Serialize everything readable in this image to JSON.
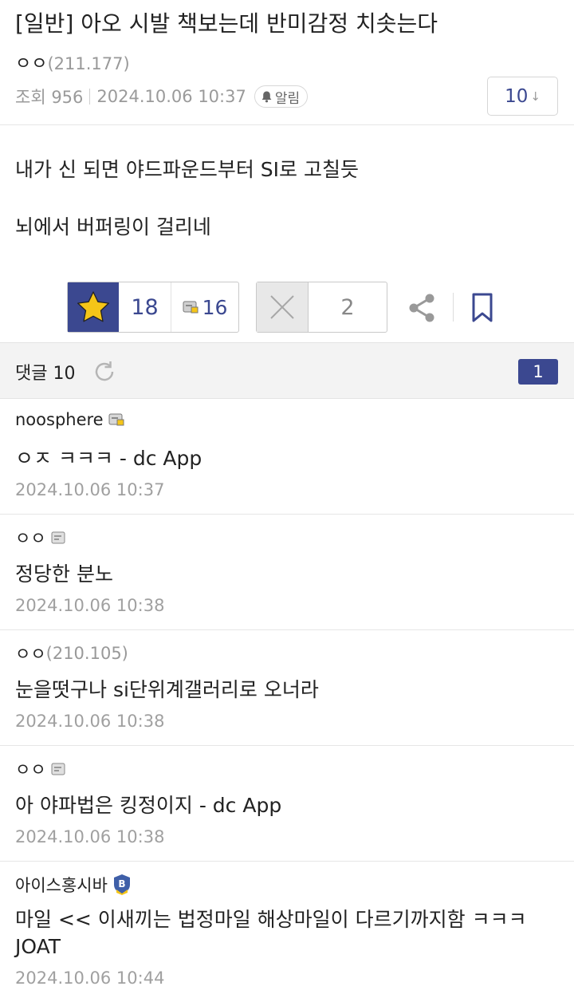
{
  "post": {
    "title": "[일반] 아오 시발 책보는데 반미감정 치솟는다",
    "author_nick": "ㅇㅇ",
    "author_ip": "(211.177)",
    "views_label": "조회 956",
    "datetime": "2024.10.06 10:37",
    "alarm_label": "알림",
    "comment_count_btn": "10",
    "comment_count_arrow": "↓",
    "body_lines": [
      "내가 신 되면 야드파운드부터 SI로 고칠듯",
      "뇌에서 버퍼링이 걸리네"
    ]
  },
  "votes": {
    "up_count": "18",
    "fix_count": "16",
    "down_count": "2"
  },
  "comments_header": {
    "label": "댓글 10",
    "page": "1"
  },
  "comments": [
    {
      "nick": "noosphere",
      "ip": "",
      "badge": "fixed-nick-icon",
      "text": "ㅇㅈ ㅋㅋㅋ - dc App",
      "date": "2024.10.06 10:37"
    },
    {
      "nick": "ㅇㅇ",
      "ip": "",
      "badge": "half-fixed-nick-icon",
      "text": "정당한 분노",
      "date": "2024.10.06 10:38"
    },
    {
      "nick": "ㅇㅇ",
      "ip": "(210.105)",
      "badge": "",
      "text": "눈을떳구나 si단위계갤러리로 오너라",
      "date": "2024.10.06 10:38"
    },
    {
      "nick": "ㅇㅇ",
      "ip": "",
      "badge": "half-fixed-nick-icon",
      "text": "아 야파법은 킹정이지 - dc App",
      "date": "2024.10.06 10:38"
    },
    {
      "nick": "아이스홍시바",
      "ip": "",
      "badge": "b-shield-icon",
      "text": "마일 << 이새끼는 법정마일 해상마일이 다르기까지함 ㅋㅋㅋ JOAT",
      "date": "2024.10.06 10:44"
    }
  ],
  "colors": {
    "accent": "#3b4890",
    "star": "#f5c518",
    "muted": "#9a9a9a"
  }
}
